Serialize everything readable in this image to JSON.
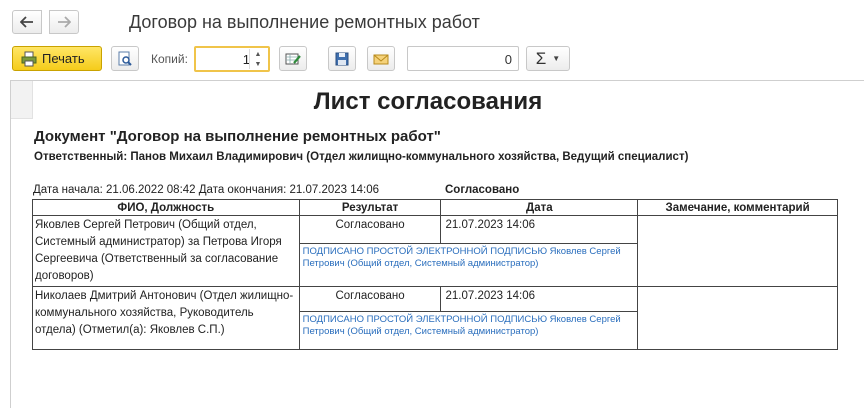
{
  "window": {
    "title": "Договор на выполнение ремонтных работ"
  },
  "toolbar": {
    "print_label": "Печать",
    "copies_label": "Копий:",
    "copies_value": "1",
    "sum_value": "0",
    "sigma_label": "Σ"
  },
  "sheet": {
    "title": "Лист согласования",
    "document_heading": "Документ \"Договор на выполнение ремонтных работ\"",
    "responsible": "Ответственный: Панов Михаил Владимирович (Отдел жилищно-коммунального хозяйства, Ведущий специалист)",
    "dates": "Дата начала: 21.06.2022 08:42 Дата окончания: 21.07.2023 14:06",
    "overall_status": "Согласовано",
    "table": {
      "headers": [
        "ФИО, Должность",
        "Результат",
        "Дата",
        "Замечание, комментарий"
      ],
      "rows": [
        {
          "fio": "Яковлев Сергей Петрович (Общий отдел, Системный администратор) за Петрова Игоря Сергеевича (Ответственный за согласование договоров)",
          "result": "Согласовано",
          "date": "21.07.2023 14:06",
          "signature": "ПОДПИСАНО ПРОСТОЙ ЭЛЕКТРОННОЙ ПОДПИСЬЮ Яковлев Сергей Петрович (Общий отдел, Системный администратор)",
          "comment": ""
        },
        {
          "fio": "Николаев Дмитрий Антонович (Отдел жилищно-коммунального хозяйства, Руководитель отдела) (Отметил(а): Яковлев С.П.)",
          "result": "Согласовано",
          "date": "21.07.2023 14:06",
          "signature": "ПОДПИСАНО ПРОСТОЙ ЭЛЕКТРОННОЙ ПОДПИСЬЮ Яковлев Сергей Петрович (Общий отдел, Системный администратор)",
          "comment": ""
        }
      ]
    }
  },
  "icons": {
    "back": "arrow-left-icon",
    "forward": "arrow-right-icon",
    "print": "printer-icon",
    "preview": "magnifier-page-icon",
    "edit": "edit-sheet-icon",
    "save": "floppy-disk-icon",
    "mail": "envelope-icon"
  },
  "colors": {
    "print_button": "#f5cc1a",
    "copies_focus": "#f0c44a",
    "signature_text": "#2a6ebd"
  }
}
